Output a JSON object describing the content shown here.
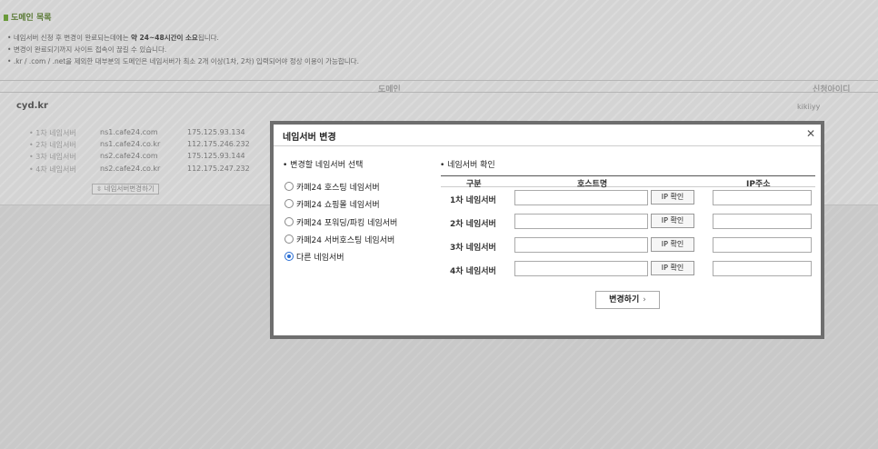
{
  "page": {
    "title": "도메인 목록",
    "notes": [
      {
        "pre": "네임서버 신청 후 변경이 완료되는데에는 ",
        "strong": "약 24~48시간이 소요",
        "post": "됩니다."
      },
      {
        "pre": "변경이 완료되기까지 사이트 접속이 끊길 수 있습니다.",
        "strong": "",
        "post": ""
      },
      {
        "pre": ".kr / .com / .net을 제외한 대부분의 도메인은 네임서버가 최소 2개 이상(1차, 2차) 입력되어야 정상 이용이 가능합니다.",
        "strong": "",
        "post": ""
      }
    ],
    "columns": {
      "domain": "도메인",
      "applicant": "신청아이디"
    },
    "domain": {
      "name": "cyd.kr",
      "owner": "kikiiyy",
      "nameservers": [
        {
          "label": "1차 네임서버",
          "host": "ns1.cafe24.com",
          "ip": "175.125.93.134"
        },
        {
          "label": "2차 네임서버",
          "host": "ns1.cafe24.co.kr",
          "ip": "112.175.246.232"
        },
        {
          "label": "3차 네임서버",
          "host": "ns2.cafe24.com",
          "ip": "175.125.93.144"
        },
        {
          "label": "4차 네임서버",
          "host": "ns2.cafe24.co.kr",
          "ip": "112.175.247.232"
        }
      ],
      "change_label": "네임서버변경하기"
    }
  },
  "popup": {
    "title": "네임서버 변경",
    "close_glyph": "✕",
    "select_title": "변경할 네임서버 선택",
    "options": [
      {
        "label": "카페24 호스팅 네임서버",
        "selected": false
      },
      {
        "label": "카페24 쇼핑몰 네임서버",
        "selected": false
      },
      {
        "label": "카페24 포워딩/파킹 네임서버",
        "selected": false
      },
      {
        "label": "카페24 서버호스팅 네임서버",
        "selected": false
      },
      {
        "label": "다른 네임서버",
        "selected": true
      }
    ],
    "confirm_title": "네임서버 확인",
    "table_headers": {
      "type": "구분",
      "host": "호스트명",
      "ip": "IP주소"
    },
    "rows": [
      {
        "label": "1차 네임서버",
        "host": "",
        "ip": ""
      },
      {
        "label": "2차 네임서버",
        "host": "",
        "ip": ""
      },
      {
        "label": "3차 네임서버",
        "host": "",
        "ip": ""
      },
      {
        "label": "4차 네임서버",
        "host": "",
        "ip": ""
      }
    ],
    "ip_check_label": "IP 확인",
    "submit_label": "변경하기",
    "submit_arrow": "›"
  }
}
